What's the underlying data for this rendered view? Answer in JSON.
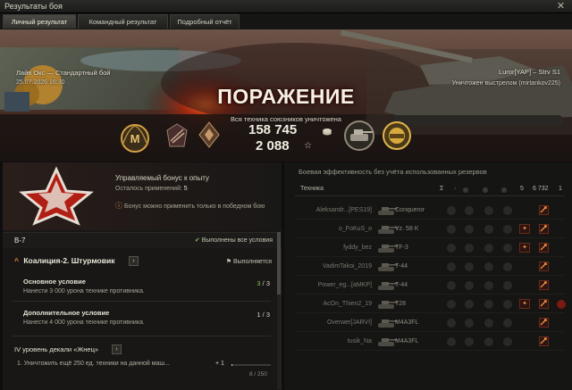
{
  "window": {
    "title": "Результаты боя",
    "close_label": "✕"
  },
  "tabs": [
    {
      "label": "Личный результат",
      "active": true
    },
    {
      "label": "Командный результат",
      "active": false
    },
    {
      "label": "Подробный отчёт",
      "active": false
    }
  ],
  "banner": {
    "map_name": "Лайв Окс — Стандартный бой",
    "date": "25.07.2026 16:30",
    "player": "Luror[YAP] – Strv S1",
    "killed_by": "Уничтожен выстрелом (mirtankov225)",
    "result": "ПОРАЖЕНИЕ",
    "result_sub": "Вся техника союзников уничтожена",
    "credits": "158 745",
    "xp": "2 088",
    "credits_icon": "credits-icon",
    "xp_icon": "☆",
    "mastery_badge": "M"
  },
  "bonus": {
    "title": "Управляемый бонус к опыту",
    "remain_label": "Осталось применений:",
    "remain_value": "5",
    "note": "Бонус можно применить только в победном бою"
  },
  "mission": {
    "code": "B-7",
    "done_label": "Выполнены все условия",
    "quest_title": "Коалиция-2. Штурмовик",
    "quest_status": "Выполняется",
    "main_title": "Основное условие",
    "main_desc": "Нанести 3 000 урона технике противника.",
    "main_val_done": "3",
    "main_val_total": "/ 3",
    "extra_title": "Дополнительное условие",
    "extra_desc": "Нанести 4 000 урона технике противника.",
    "extra_val": "1 / 3",
    "decal_title": "IV уровень декали «Жнец»",
    "decal_task": "1. Уничтожить ещё 250 ед. техники на данной маш...",
    "decal_plus": "+ 1",
    "decal_progress": 0.03,
    "decal_count": "8 / 250"
  },
  "efficiency": {
    "title": "Боевая эффективность без учёта использованных резервов",
    "header": {
      "tech": "Техника",
      "c1": "Σ",
      "c5": "5",
      "c6": "6 732",
      "c7": "1"
    },
    "rows": [
      {
        "player": "Aleksandr...[PES19]",
        "tank": "Conqueror",
        "red_tag": false,
        "crit": false
      },
      {
        "player": "o_FoKuS_o",
        "tank": "Vz. 58 K",
        "red_tag": true,
        "crit": false
      },
      {
        "player": "fyddy_bez",
        "tank": "TF-3",
        "red_tag": true,
        "crit": false
      },
      {
        "player": "VadimTakoi_2019",
        "tank": "T-44",
        "red_tag": false,
        "crit": false
      },
      {
        "player": "Power_eg...[aMKP]",
        "tank": "T-44",
        "red_tag": false,
        "crit": false
      },
      {
        "player": "AcOn_Thien2_19",
        "tank": "T28",
        "red_tag": true,
        "crit": true
      },
      {
        "player": "Overwer[JARVI]",
        "tank": "M4A3FL",
        "red_tag": false,
        "crit": false
      },
      {
        "player": "tusik_Na",
        "tank": "M4A3FL",
        "red_tag": false,
        "crit": false
      }
    ]
  },
  "colors": {
    "accent": "#e2803a",
    "done": "#7fc04a",
    "banner_red": "#b52a1c"
  }
}
